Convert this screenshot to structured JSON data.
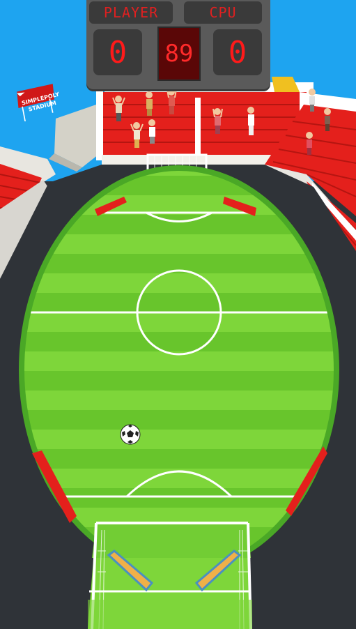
{
  "scoreboard": {
    "player_label": "PLAYER",
    "cpu_label": "CPU",
    "player_score": "0",
    "cpu_score": "0",
    "timer": "89"
  },
  "stadium_sign": {
    "line1": "SIMPLEPOLY",
    "line2": "STADIUM"
  },
  "colors": {
    "sky": "#1ea4f0",
    "stand_red": "#e4201c",
    "pitch_light": "#7ed63a",
    "pitch_dark": "#66c42a",
    "track": "#2f3338",
    "scoreboard_bg": "#5a5a5a",
    "digit_red": "#ff1a1a"
  }
}
